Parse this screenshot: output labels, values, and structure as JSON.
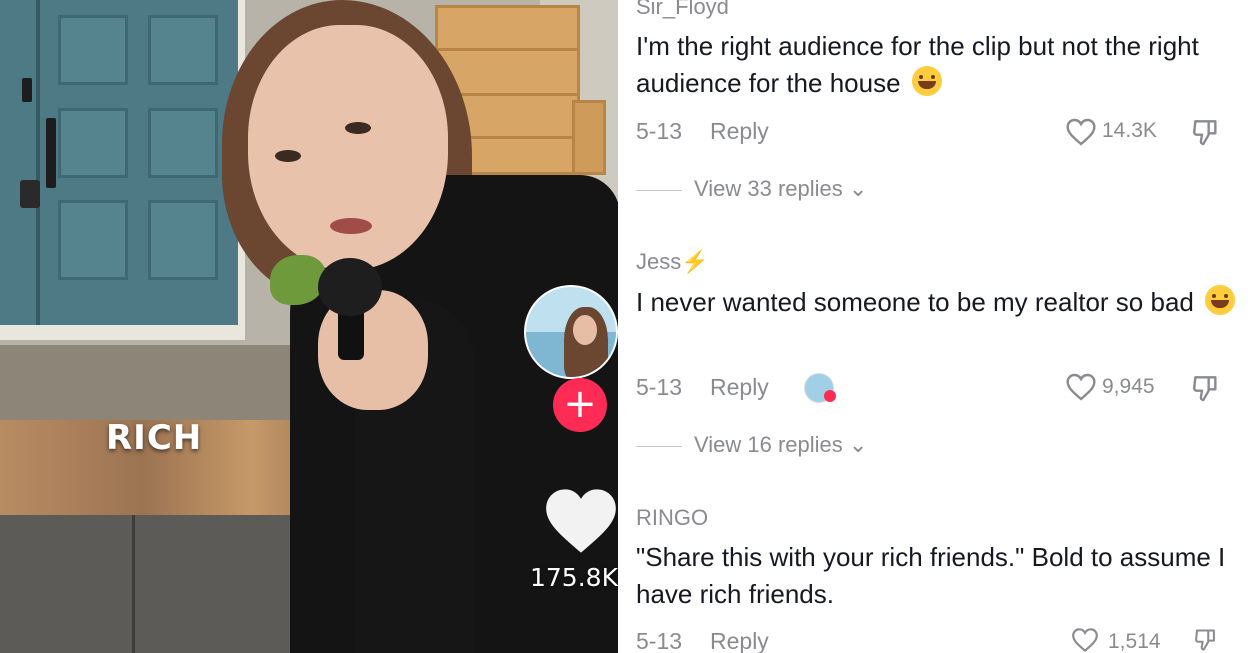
{
  "video": {
    "caption_word": "RICH",
    "like_count": "175.8K",
    "follow_symbol": "+"
  },
  "comments": [
    {
      "username": "Sir_Floyd",
      "text": "I'm the right audience for the clip but not the right audience for the house",
      "emoji": "sweat-smile-emoji",
      "date": "5-13",
      "reply_label": "Reply",
      "likes": "14.3K",
      "view_replies": "View 33 replies"
    },
    {
      "username": "Jess",
      "username_badge": "⚡",
      "text": "I never wanted someone to be my realtor so bad",
      "emoji": "tears-of-joy-emoji",
      "date": "5-13",
      "reply_label": "Reply",
      "likes": "9,945",
      "view_replies": "View 16 replies"
    },
    {
      "username": "RINGO",
      "text": "\"Share this with your rich friends.\" Bold to assume I have rich friends.",
      "date": "5-13",
      "reply_label": "Reply",
      "likes": "1,514"
    }
  ],
  "colors": {
    "accent": "#fe2c55",
    "muted_text": "#8a8b91",
    "text": "#161823"
  }
}
